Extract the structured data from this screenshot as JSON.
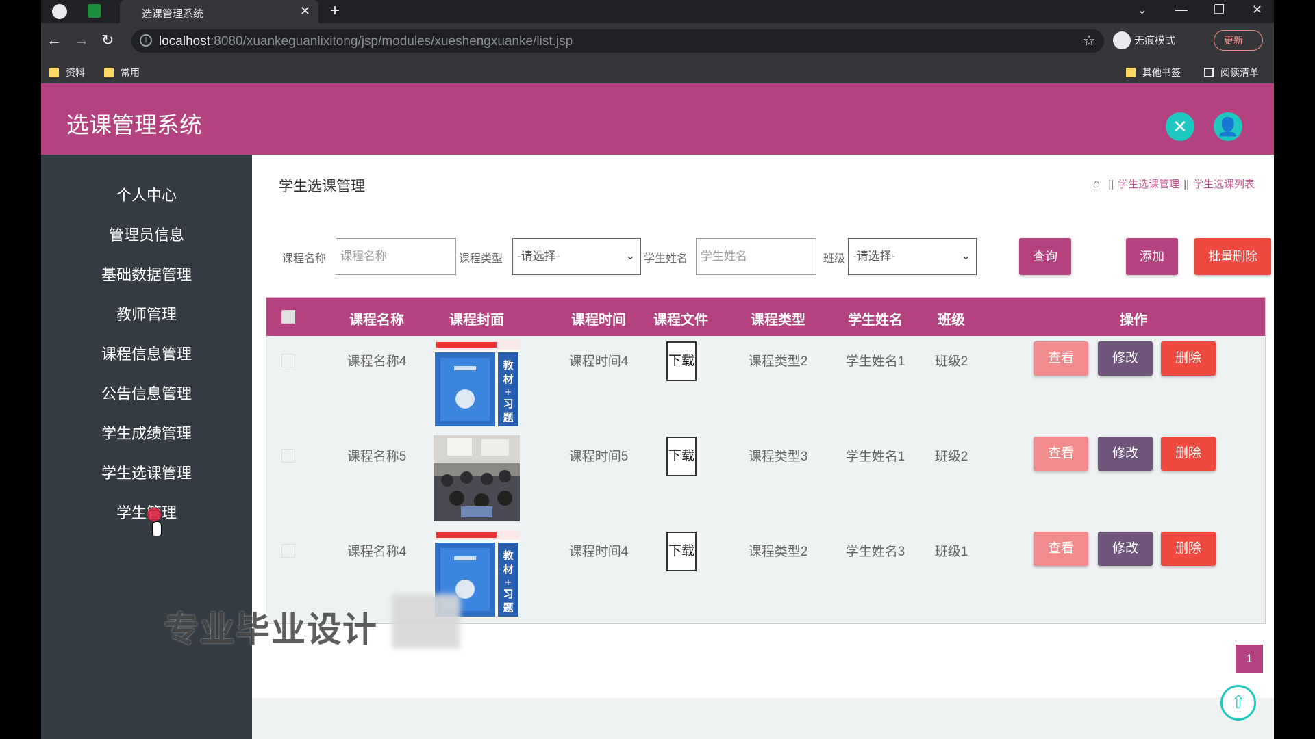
{
  "browser": {
    "tab_title": "选课管理系统",
    "url_host": "localhost",
    "url_path": ":8080/xuankeguanlixitong/jsp/modules/xueshengxuanke/list.jsp",
    "incognito_label": "无痕模式",
    "update_label": "更新",
    "bookmarks": [
      "资料",
      "常用"
    ],
    "bookmarks_right": [
      "其他书签",
      "阅读清单"
    ]
  },
  "app": {
    "title": "选课管理系统",
    "header_color": "#b4427f",
    "accent": "#1ec8c0"
  },
  "sidebar": {
    "items": [
      "个人中心",
      "管理员信息",
      "基础数据管理",
      "教师管理",
      "课程信息管理",
      "公告信息管理",
      "学生成绩管理",
      "学生选课管理",
      "学生管理"
    ]
  },
  "page": {
    "title": "学生选课管理",
    "breadcrumb": [
      "学生选课管理",
      "学生选课列表"
    ]
  },
  "filters": {
    "course_name_label": "课程名称",
    "course_name_placeholder": "课程名称",
    "course_type_label": "课程类型",
    "course_type_value": "-请选择-",
    "student_name_label": "学生姓名",
    "student_name_placeholder": "学生姓名",
    "class_label": "班级",
    "class_value": "-请选择-"
  },
  "actions": {
    "search": "查询",
    "add": "添加",
    "batch_delete": "批量删除"
  },
  "table": {
    "headers": [
      "课程名称",
      "课程封面",
      "课程时间",
      "课程文件",
      "课程类型",
      "学生姓名",
      "班级",
      "操作"
    ],
    "rows": [
      {
        "course_name": "课程名称4",
        "cover": "book-cover",
        "time": "课程时间4",
        "file": "下载",
        "type": "课程类型2",
        "student": "学生姓名1",
        "class": "班级2"
      },
      {
        "course_name": "课程名称5",
        "cover": "classroom-photo",
        "time": "课程时间5",
        "file": "下载",
        "type": "课程类型3",
        "student": "学生姓名1",
        "class": "班级2"
      },
      {
        "course_name": "课程名称4",
        "cover": "book-cover",
        "time": "课程时间4",
        "file": "下载",
        "type": "课程类型2",
        "student": "学生姓名3",
        "class": "班级1"
      }
    ],
    "row_actions": {
      "view": "查看",
      "edit": "修改",
      "delete": "删除"
    }
  },
  "pagination": {
    "current": "1"
  },
  "overlay": {
    "watermark": "专业毕业设计"
  }
}
